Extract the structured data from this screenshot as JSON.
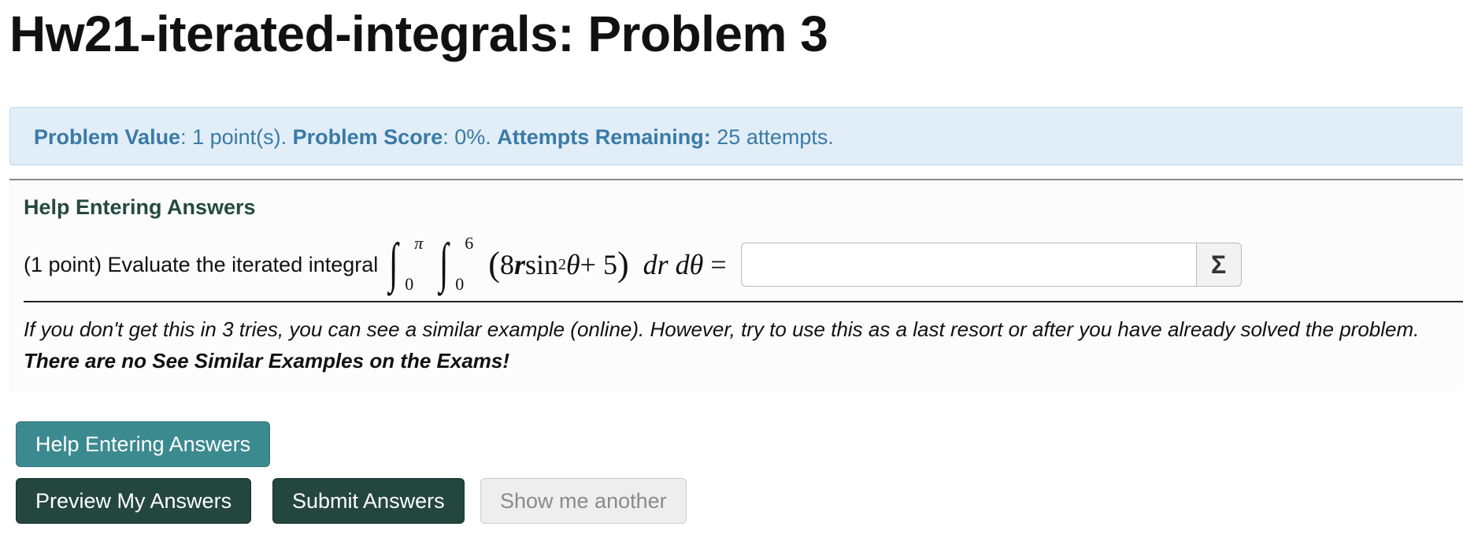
{
  "header": {
    "title": "Hw21-iterated-integrals: Problem 3"
  },
  "info_bar": {
    "value_label": "Problem Value",
    "value_text": ": 1 point(s). ",
    "score_label": "Problem Score",
    "score_text": ": 0%. ",
    "attempts_label": "Attempts Remaining:",
    "attempts_text": " 25 attempts."
  },
  "problem": {
    "help_heading": "Help Entering Answers",
    "prompt": "(1 point) Evaluate the iterated integral",
    "math": {
      "outer_upper": "π",
      "outer_lower": "0",
      "inner_upper": "6",
      "inner_lower": "0",
      "integrand_open": "(",
      "coef": "8",
      "var_r": "r",
      "sin": " sin",
      "exp": "2",
      "theta": " θ",
      "plus_const": " + 5",
      "integrand_close": ")",
      "differentials": "dr dθ",
      "equals": "="
    },
    "answer": {
      "value": "",
      "placeholder": "",
      "equation_button_glyph": "Σ"
    },
    "note_text": "If you don't get this in 3 tries, you can see a similar example (online). However, try to use this as a last resort or after you have already solved the problem. ",
    "note_bold": "There are no See Similar Examples on the Exams!"
  },
  "buttons": {
    "help": "Help Entering Answers",
    "preview": "Preview My Answers",
    "submit": "Submit Answers",
    "another": "Show me another"
  }
}
